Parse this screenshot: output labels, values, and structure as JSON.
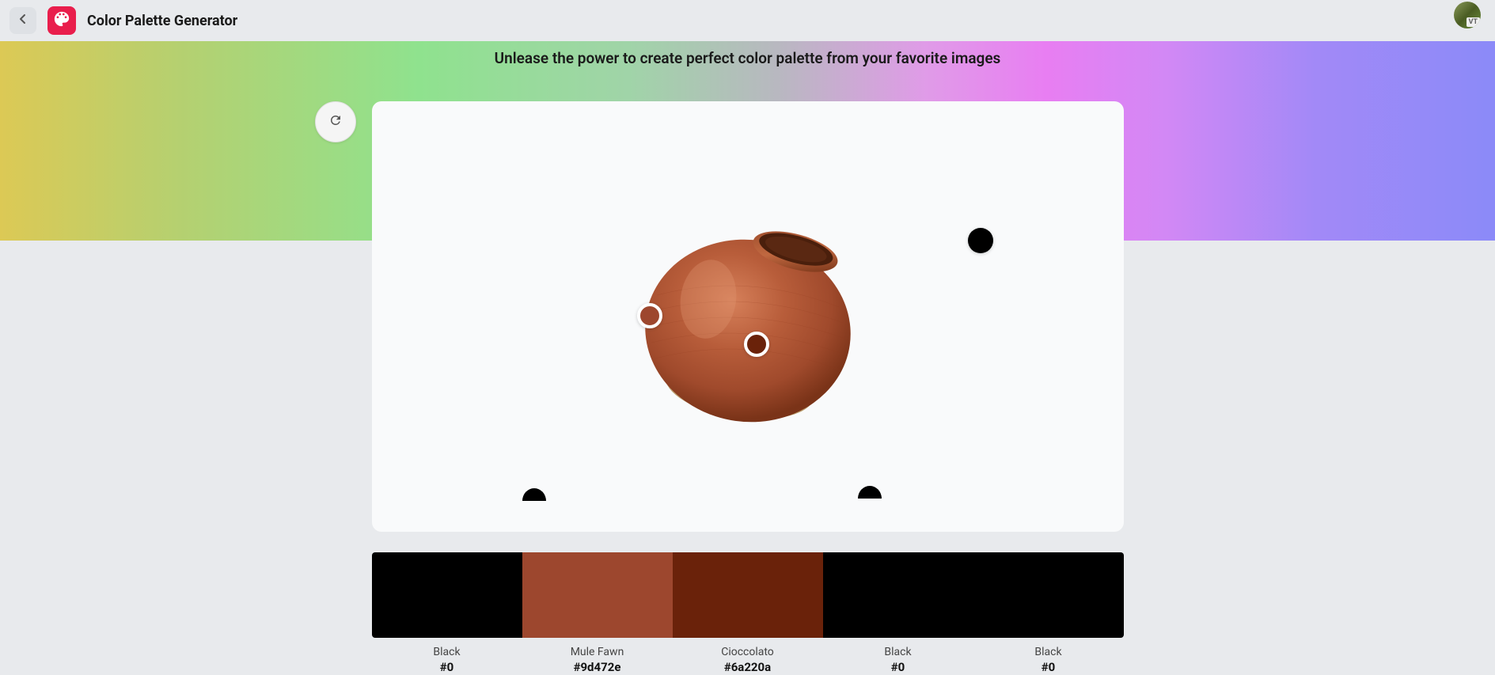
{
  "header": {
    "title": "Color Palette Generator",
    "user_badge": "VT"
  },
  "tagline": "Unlease the power to create perfect color palette from your favorite images",
  "palette": [
    {
      "name": "Black",
      "hex": "#0",
      "color": "#000000"
    },
    {
      "name": "Mule Fawn",
      "hex": "#9d472e",
      "color": "#9d472e"
    },
    {
      "name": "Cioccolato",
      "hex": "#6a220a",
      "color": "#6a220a"
    },
    {
      "name": "Black",
      "hex": "#0",
      "color": "#000000"
    },
    {
      "name": "Black",
      "hex": "#0",
      "color": "#000000"
    }
  ]
}
